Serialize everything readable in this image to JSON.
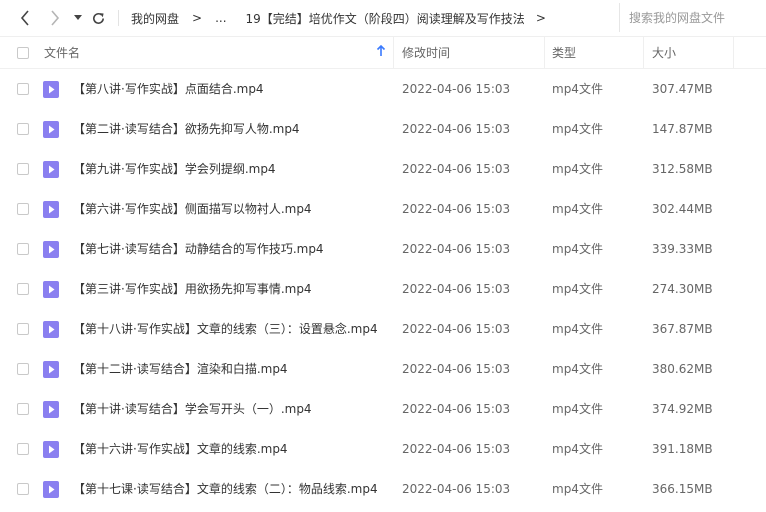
{
  "nav": {
    "back_icon": "chevron-left-icon",
    "forward_icon": "chevron-right-icon",
    "dropdown_icon": "caret-down-icon",
    "refresh_icon": "refresh-icon",
    "breadcrumb": {
      "root": "我的网盘",
      "sep": ">",
      "ellipsis": "...",
      "current": "19【完结】培优作文（阶段四）阅读理解及写作技法",
      "trailing_sep": ">"
    }
  },
  "search": {
    "placeholder": "搜索我的网盘文件"
  },
  "columns": {
    "name": "文件名",
    "modified": "修改时间",
    "type": "类型",
    "size": "大小",
    "sort_icon": "arrow-up-icon",
    "sort_color": "#3a7afe"
  },
  "file_icon_color": "#8a7ff0",
  "files": [
    {
      "name": "【第八讲·写作实战】点面结合.mp4",
      "modified": "2022-04-06 15:03",
      "type": "mp4文件",
      "size": "307.47MB"
    },
    {
      "name": "【第二讲·读写结合】欲扬先抑写人物.mp4",
      "modified": "2022-04-06 15:03",
      "type": "mp4文件",
      "size": "147.87MB"
    },
    {
      "name": "【第九讲·写作实战】学会列提纲.mp4",
      "modified": "2022-04-06 15:03",
      "type": "mp4文件",
      "size": "312.58MB"
    },
    {
      "name": "【第六讲·写作实战】侧面描写以物衬人.mp4",
      "modified": "2022-04-06 15:03",
      "type": "mp4文件",
      "size": "302.44MB"
    },
    {
      "name": "【第七讲·读写结合】动静结合的写作技巧.mp4",
      "modified": "2022-04-06 15:03",
      "type": "mp4文件",
      "size": "339.33MB"
    },
    {
      "name": "【第三讲·写作实战】用欲扬先抑写事情.mp4",
      "modified": "2022-04-06 15:03",
      "type": "mp4文件",
      "size": "274.30MB"
    },
    {
      "name": "【第十八讲·写作实战】文章的线索（三）：设置悬念.mp4",
      "modified": "2022-04-06 15:03",
      "type": "mp4文件",
      "size": "367.87MB"
    },
    {
      "name": "【第十二讲·读写结合】渲染和白描.mp4",
      "modified": "2022-04-06 15:03",
      "type": "mp4文件",
      "size": "380.62MB"
    },
    {
      "name": "【第十讲·读写结合】学会写开头（一）.mp4",
      "modified": "2022-04-06 15:03",
      "type": "mp4文件",
      "size": "374.92MB"
    },
    {
      "name": "【第十六讲·写作实战】文章的线索.mp4",
      "modified": "2022-04-06 15:03",
      "type": "mp4文件",
      "size": "391.18MB"
    },
    {
      "name": "【第十七课·读写结合】文章的线索（二）：物品线索.mp4",
      "modified": "2022-04-06 15:03",
      "type": "mp4文件",
      "size": "366.15MB"
    }
  ]
}
